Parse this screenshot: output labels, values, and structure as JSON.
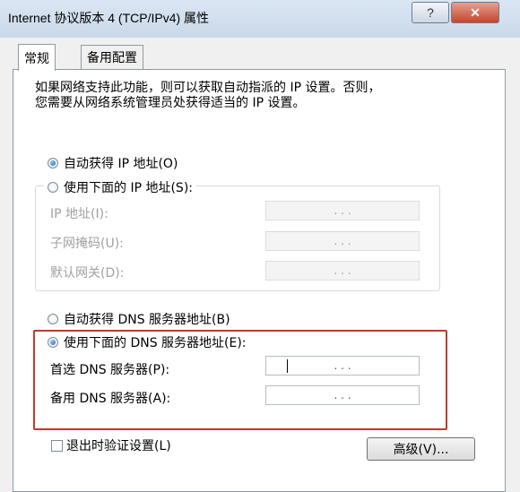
{
  "window": {
    "title": "Internet 协议版本 4 (TCP/IPv4) 属性",
    "help_label": "?",
    "close_label": "✕"
  },
  "tabs": [
    {
      "label": "常规",
      "active": true
    },
    {
      "label": "备用配置",
      "active": false
    }
  ],
  "intro": {
    "line1": "如果网络支持此功能，则可以获取自动指派的 IP 设置。否则，",
    "line2": "您需要从网络系统管理员处获得适当的 IP 设置。"
  },
  "ip": {
    "auto_label": "自动获得 IP 地址(O)",
    "manual_label": "使用下面的 IP 地址(S):",
    "selected": "auto",
    "fields": [
      {
        "label": "IP 地址(I):",
        "value": ". . ."
      },
      {
        "label": "子网掩码(U):",
        "value": ". . ."
      },
      {
        "label": "默认网关(D):",
        "value": ". . ."
      }
    ]
  },
  "dns": {
    "auto_label": "自动获得 DNS 服务器地址(B)",
    "manual_label": "使用下面的 DNS 服务器地址(E):",
    "selected": "manual",
    "fields": [
      {
        "label": "首选 DNS 服务器(P):",
        "value": ". . ."
      },
      {
        "label": "备用 DNS 服务器(A):",
        "value": ". . ."
      }
    ]
  },
  "validate": {
    "label": "退出时验证设置(L)",
    "checked": false
  },
  "advanced_label": "高级(V)...",
  "colors": {
    "highlight_border": "#c0392b",
    "titlebar": "#c9d8ea"
  }
}
